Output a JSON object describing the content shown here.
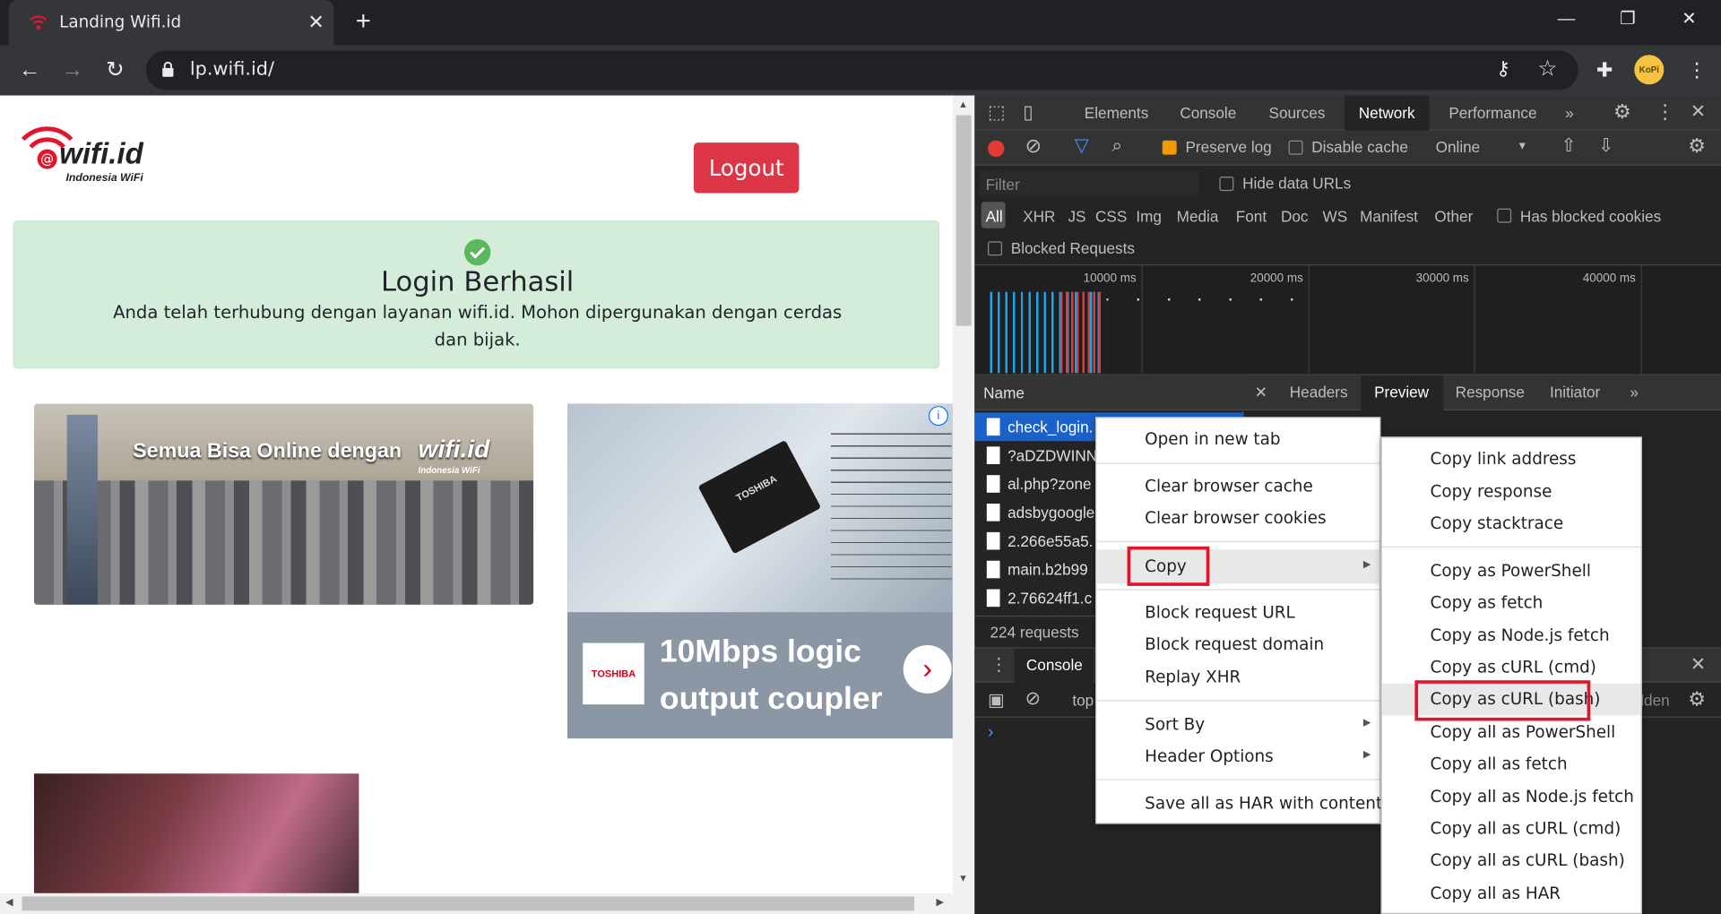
{
  "browser": {
    "tab_title": "Landing Wifi.id",
    "tab_close": "✕",
    "new_tab": "+",
    "url": "lp.wifi.id/",
    "window_controls": [
      "—",
      "❐",
      "✕"
    ],
    "profile_label": "KoPi"
  },
  "page": {
    "logo_text": "wifi.id",
    "logo_sub": "Indonesia WiFi",
    "logout_label": "Logout",
    "alert_title": "Login Berhasil",
    "alert_text": "Anda telah terhubung dengan layanan wifi.id. Mohon dipergunakan dengan cerdas dan bijak.",
    "banner_text": "Semua Bisa Online dengan",
    "banner_logo": "wifi.id",
    "banner_logo_sub": "Indonesia WiFi",
    "ad_logo": "TOSHIBA",
    "ad_chip_label": "TOSHIBA",
    "ad_headline": "10Mbps logic output coupler",
    "ad_arrow": "›",
    "ad_info": "i"
  },
  "devtools": {
    "tabs": [
      "Elements",
      "Console",
      "Sources",
      "Network",
      "Performance"
    ],
    "active_tab": "Network",
    "more_tabs": "»",
    "toolbar": {
      "preserve_log": "Preserve log",
      "disable_cache": "Disable cache",
      "throttle": "Online",
      "throttle_arrow": "▼"
    },
    "filter_placeholder": "Filter",
    "hide_data_urls": "Hide data URLs",
    "types": [
      "All",
      "XHR",
      "JS",
      "CSS",
      "Img",
      "Media",
      "Font",
      "Doc",
      "WS",
      "Manifest",
      "Other"
    ],
    "has_blocked_cookies": "Has blocked cookies",
    "blocked_requests": "Blocked Requests",
    "overview_ticks": [
      "10000 ms",
      "20000 ms",
      "30000 ms",
      "40000 ms"
    ],
    "name_header": "Name",
    "requests": [
      "check_login.",
      "?aDZDWINN",
      "al.php?zone",
      "adsbygoogle",
      "2.266e55a5.",
      "main.b2b99",
      "2.76624ff1.c"
    ],
    "requests_count": "224 requests",
    "preview_tabs": [
      "Headers",
      "Preview",
      "Response",
      "Initiator"
    ],
    "preview_close": "✕",
    "preview_more": "»",
    "console_label": "Console",
    "console_context": "top",
    "console_hidden": "dden",
    "console_prompt": "›"
  },
  "context_menu": {
    "items": [
      "Open in new tab",
      "Clear browser cache",
      "Clear browser cookies",
      "Copy",
      "Block request URL",
      "Block request domain",
      "Replay XHR",
      "Sort By",
      "Header Options",
      "Save all as HAR with content"
    ],
    "submenu_arrow": "▶"
  },
  "copy_submenu": {
    "items": [
      "Copy link address",
      "Copy response",
      "Copy stacktrace",
      "Copy as PowerShell",
      "Copy as fetch",
      "Copy as Node.js fetch",
      "Copy as cURL (cmd)",
      "Copy as cURL (bash)",
      "Copy all as PowerShell",
      "Copy all as fetch",
      "Copy all as Node.js fetch",
      "Copy all as cURL (cmd)",
      "Copy all as cURL (bash)",
      "Copy all as HAR"
    ],
    "highlighted": "Copy as cURL (bash)"
  },
  "colors": {
    "brand_red": "#dc3545",
    "alert_bg": "#d4edda",
    "highlight_box": "#e0162b",
    "record_red": "#e53935",
    "selected_row": "#1a62c9"
  }
}
